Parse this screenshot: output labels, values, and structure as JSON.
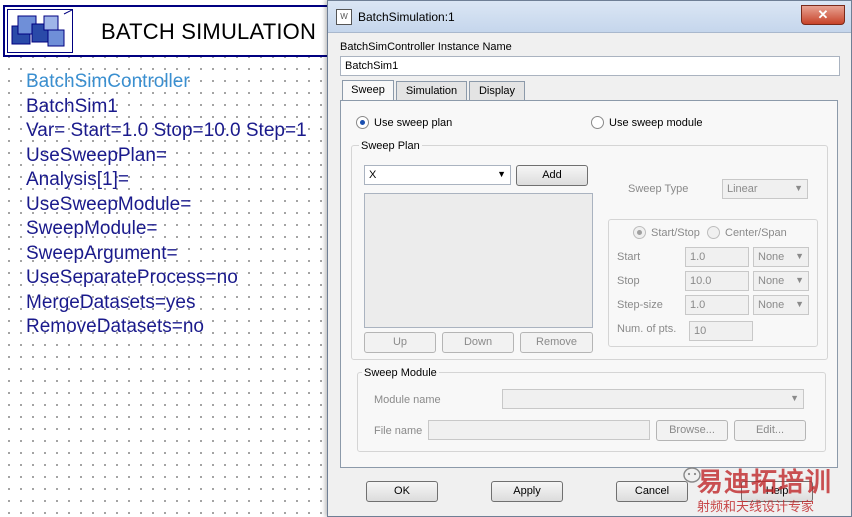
{
  "schematic": {
    "title": "BATCH SIMULATION",
    "params": [
      "BatchSimController",
      "BatchSim1",
      "Var= Start=1.0 Stop=10.0 Step=1",
      "UseSweepPlan=",
      "Analysis[1]=",
      "UseSweepModule=",
      "SweepModule=",
      "SweepArgument=",
      "UseSeparateProcess=no",
      "MergeDatasets=yes",
      "RemoveDatasets=no"
    ]
  },
  "dialog": {
    "title": "BatchSimulation:1",
    "close": "✕",
    "instance_label": "BatchSimController Instance Name",
    "instance_value": "BatchSim1",
    "tabs": [
      "Sweep",
      "Simulation",
      "Display"
    ],
    "radio_plan": "Use sweep plan",
    "radio_module": "Use sweep module",
    "sweep_plan": {
      "legend": "Sweep Plan",
      "var_select": "X",
      "add": "Add",
      "up": "Up",
      "down": "Down",
      "remove": "Remove",
      "sweep_type_label": "Sweep Type",
      "sweep_type_value": "Linear",
      "start_stop": "Start/Stop",
      "center_span": "Center/Span",
      "start_label": "Start",
      "start_value": "1.0",
      "start_unit": "None",
      "stop_label": "Stop",
      "stop_value": "10.0",
      "stop_unit": "None",
      "step_label": "Step-size",
      "step_value": "1.0",
      "step_unit": "None",
      "num_label": "Num. of pts.",
      "num_value": "10"
    },
    "sweep_module": {
      "legend": "Sweep Module",
      "module_label": "Module name",
      "module_value": "",
      "file_label": "File name",
      "file_value": "",
      "browse": "Browse...",
      "edit": "Edit..."
    },
    "buttons": {
      "ok": "OK",
      "apply": "Apply",
      "cancel": "Cancel",
      "help": "Help"
    }
  },
  "watermark": {
    "line1": "易迪拓培训",
    "line2": "射频和天线设计专家"
  }
}
